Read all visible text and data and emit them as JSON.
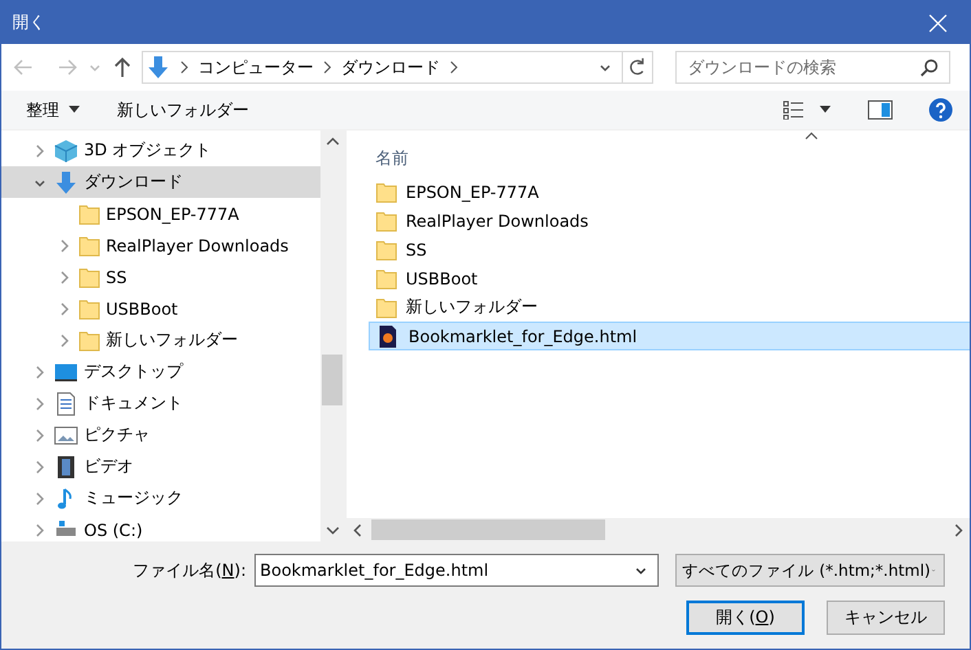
{
  "window": {
    "title": "開く"
  },
  "address_bar": {
    "path": [
      "コンピューター",
      "ダウンロード"
    ]
  },
  "search": {
    "placeholder": "ダウンロードの検索"
  },
  "toolbar": {
    "organize": "整理",
    "new_folder": "新しいフォルダー"
  },
  "tree": [
    {
      "label": "3D オブジェクト",
      "kind": "cube",
      "expanded": false,
      "selected": false
    },
    {
      "label": "ダウンロード",
      "kind": "download",
      "expanded": true,
      "selected": true,
      "children": [
        {
          "label": "EPSON_EP-777A",
          "kind": "folder",
          "selected": false
        },
        {
          "label": "RealPlayer Downloads",
          "kind": "folder",
          "expanded": false,
          "selected": false
        },
        {
          "label": "SS",
          "kind": "folder",
          "expanded": false,
          "selected": false
        },
        {
          "label": "USBBoot",
          "kind": "folder",
          "expanded": false,
          "selected": false
        },
        {
          "label": "新しいフォルダー",
          "kind": "folder",
          "expanded": false,
          "selected": false
        }
      ]
    },
    {
      "label": "デスクトップ",
      "kind": "desktop",
      "expanded": false,
      "selected": false
    },
    {
      "label": "ドキュメント",
      "kind": "document",
      "expanded": false,
      "selected": false
    },
    {
      "label": "ピクチャ",
      "kind": "picture",
      "expanded": false,
      "selected": false
    },
    {
      "label": "ビデオ",
      "kind": "video",
      "expanded": false,
      "selected": false
    },
    {
      "label": "ミュージック",
      "kind": "music",
      "expanded": false,
      "selected": false
    },
    {
      "label": "OS (C:)",
      "kind": "drive",
      "expanded": false,
      "selected": false
    }
  ],
  "file_list": {
    "column": "名前",
    "files": [
      {
        "name": "EPSON_EP-777A",
        "kind": "folder",
        "selected": false
      },
      {
        "name": "RealPlayer Downloads",
        "kind": "folder",
        "selected": false
      },
      {
        "name": "SS",
        "kind": "folder",
        "selected": false
      },
      {
        "name": "USBBoot",
        "kind": "folder",
        "selected": false
      },
      {
        "name": "新しいフォルダー",
        "kind": "folder",
        "selected": false
      },
      {
        "name": "Bookmarklet_for_Edge.html",
        "kind": "html",
        "selected": true
      }
    ]
  },
  "footer": {
    "filename_label": [
      "ファイル名(",
      "N",
      "):"
    ],
    "filename": "Bookmarklet_for_Edge.html",
    "file_type": "すべてのファイル (*.htm;*.html)",
    "buttons": [
      {
        "label": [
          "開く(",
          "O",
          ")"
        ],
        "default": true
      },
      {
        "label": [
          "キャンセル"
        ],
        "default": false
      }
    ]
  }
}
